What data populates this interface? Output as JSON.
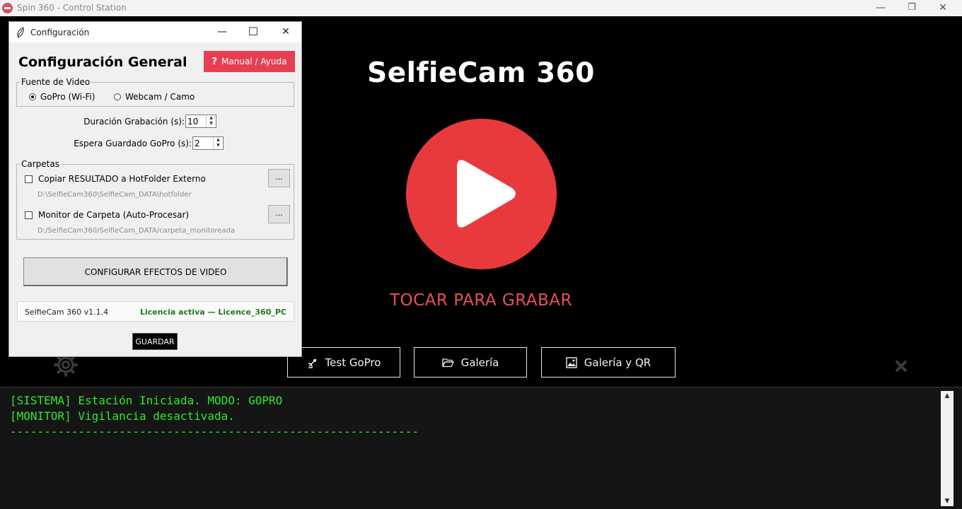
{
  "window": {
    "title": "Spin 360 - Control Station",
    "minimize": "—",
    "maximize": "❐",
    "close": "✕"
  },
  "main": {
    "title": "SelfieCam 360",
    "record_caption": "TOCAR PARA GRABAR",
    "buttons": {
      "test_gopro": "Test GoPro",
      "gallery": "Galería",
      "gallery_qr": "Galería y QR"
    },
    "colors": {
      "record": "#e83a3d",
      "caption": "#e8505a"
    }
  },
  "console": {
    "lines": [
      "[SISTEMA] Estación Iniciada. MODO: GOPRO",
      "[MONITOR] Vigilancia desactivada.",
      "------------------------------------------------------------"
    ],
    "color": "#2ee82e",
    "scroll_up": "▲",
    "scroll_down": "▼"
  },
  "dialog": {
    "title": "Configuración",
    "minimize": "—",
    "maximize": "☐",
    "close": "✕",
    "heading": "Configuración General",
    "help_label": "Manual / Ayuda",
    "video_source": {
      "legend": "Fuente de Video",
      "options": [
        "GoPro (Wi-Fi)",
        "Webcam / Camo"
      ],
      "selected": "GoPro (Wi-Fi)"
    },
    "duration": {
      "label": "Duración Grabación (s):",
      "value": "10"
    },
    "save_wait": {
      "label": "Espera Guardado GoPro (s):",
      "value": "2"
    },
    "folders": {
      "legend": "Carpetas",
      "copy_result": {
        "label": "Copiar RESULTADO a HotFolder Externo",
        "checked": false,
        "path": "D:\\SelfieCam360\\SelfieCam_DATA\\hotfolder",
        "browse": "..."
      },
      "monitor": {
        "label": "Monitor de Carpeta (Auto-Procesar)",
        "checked": false,
        "path": "D:/SelfieCam360/SelfieCam_DATA/carpeta_monitoreada",
        "browse": "..."
      }
    },
    "effects_button": "CONFIGURAR EFECTOS DE VIDEO",
    "version": "SelfieCam 360  v1.1.4",
    "license": "Licencia activa  —  Licence_360_PC",
    "save_button": "GUARDAR",
    "colors": {
      "help": "#e83e52",
      "license": "#1f7a1f"
    }
  }
}
